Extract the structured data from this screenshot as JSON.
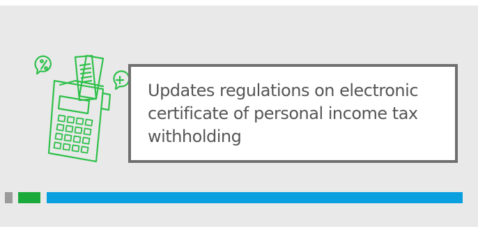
{
  "banner": {
    "title": "Updates regulations on electronic certificate of personal income tax withholding",
    "colors": {
      "background": "#e9e9e9",
      "accent_green": "#2ec04a",
      "box_border": "#6f6f6f",
      "text": "#555555",
      "bar_gray": "#9b9b9b",
      "bar_green": "#1aaa3c",
      "bar_blue": "#0aa0e0"
    },
    "icons": [
      "pos-terminal-icon",
      "receipt-icon",
      "percent-bubble-icon",
      "plus-bubble-icon"
    ]
  }
}
